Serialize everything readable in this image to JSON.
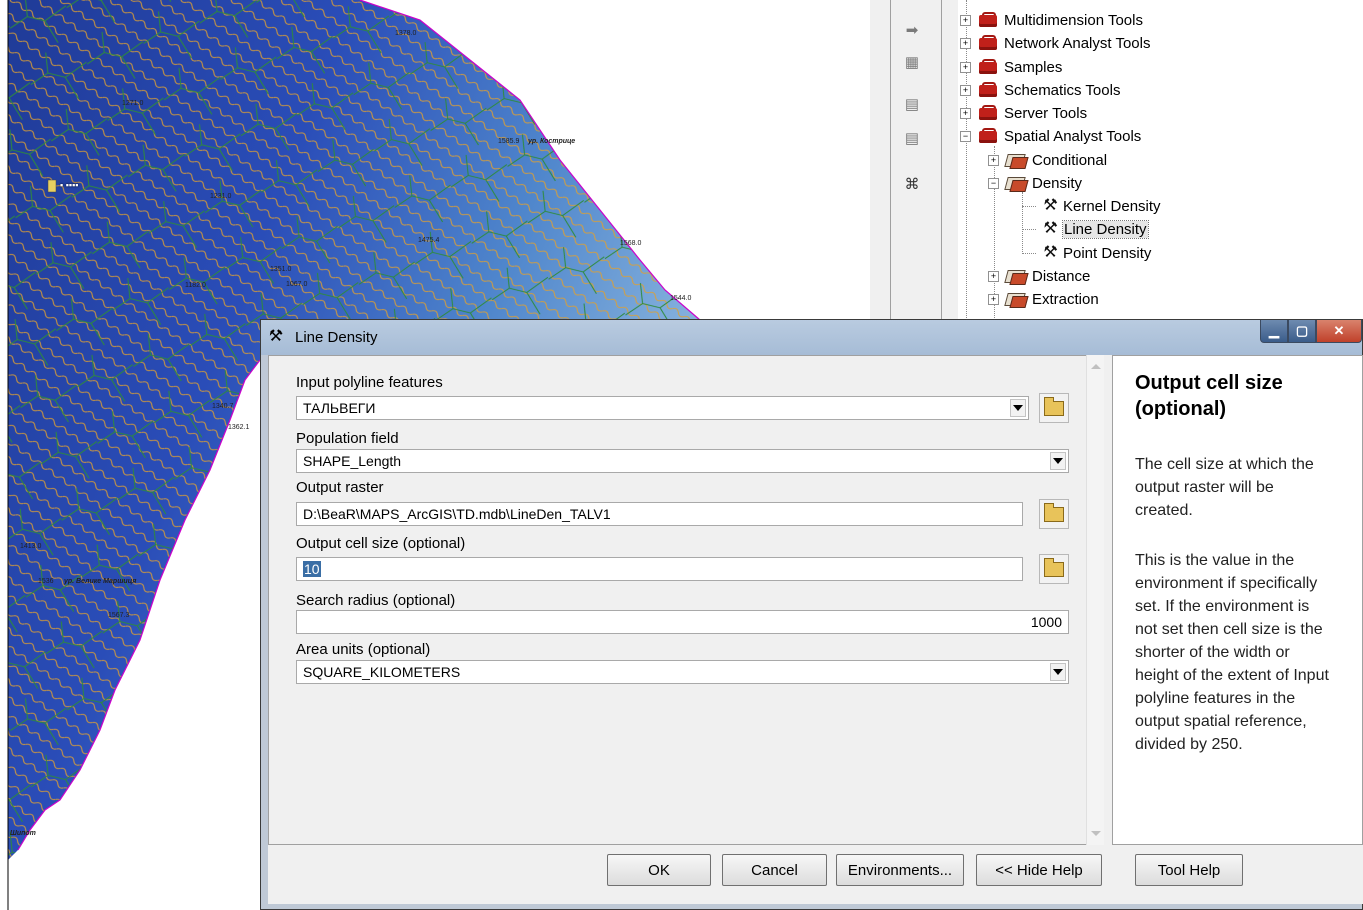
{
  "map": {
    "labels": {
      "l1": "1378.0",
      "l2": "1271.0",
      "l3": "1585.9",
      "l4": "ур. Кострице",
      "l5": "1568.0",
      "l6": "1544.0",
      "l7": "1475.4",
      "l8": "1182.0",
      "l9": "1231.0",
      "l10": "1340.7",
      "l11": "1362.1",
      "l12": "1413.0",
      "l13": "1536",
      "l14": "ур. Велике Маршиця",
      "l15": "1567.3",
      "l16": "Шипот",
      "l17": "1351.0",
      "l18": "1067.0"
    }
  },
  "toolbox": {
    "items": [
      {
        "label": "Multidimension Tools",
        "expander": "+"
      },
      {
        "label": "Network Analyst Tools",
        "expander": "+"
      },
      {
        "label": "Samples",
        "expander": "+"
      },
      {
        "label": "Schematics Tools",
        "expander": "+"
      },
      {
        "label": "Server Tools",
        "expander": "+"
      },
      {
        "label": "Spatial Analyst Tools",
        "expander": "−"
      },
      {
        "label": "Conditional",
        "expander": "+"
      },
      {
        "label": "Density",
        "expander": "−"
      },
      {
        "label": "Kernel Density"
      },
      {
        "label": "Line Density"
      },
      {
        "label": "Point Density"
      },
      {
        "label": "Distance",
        "expander": "+"
      },
      {
        "label": "Extraction",
        "expander": "+"
      }
    ]
  },
  "dialog": {
    "title": "Line Density",
    "fields": {
      "input_features_label": "Input polyline features",
      "input_features_value": "ТАЛЬВЕГИ",
      "population_label": "Population field",
      "population_value": "SHAPE_Length",
      "output_raster_label": "Output raster",
      "output_raster_value": "D:\\BeaR\\MAPS_ArcGIS\\TD.mdb\\LineDen_TALV1",
      "cell_size_label": "Output cell size (optional)",
      "cell_size_value": "10",
      "search_radius_label": "Search radius (optional)",
      "search_radius_value": "1000",
      "area_units_label": "Area units (optional)",
      "area_units_value": "SQUARE_KILOMETERS"
    },
    "help": {
      "title": "Output cell size (optional)",
      "p1": "The cell size at which the output raster will be created.",
      "p2": "This is the value in the environment if specifically set. If the environment is not set then cell size is the shorter of the width or height of the extent of Input polyline features in the output spatial reference, divided by 250."
    },
    "buttons": {
      "ok": "OK",
      "cancel": "Cancel",
      "environments": "Environments...",
      "hide_help": "<< Hide Help",
      "tool_help": "Tool Help"
    }
  },
  "colors": {
    "tree_selected": "#e6e6e6",
    "dialog_frame": "#bfc9d6",
    "map_deep": "#1e3a9a",
    "map_light": "#9fc4e4",
    "contour": "#e0a030",
    "stream": "#2e8b3a",
    "boundary": "#cc00cc"
  }
}
